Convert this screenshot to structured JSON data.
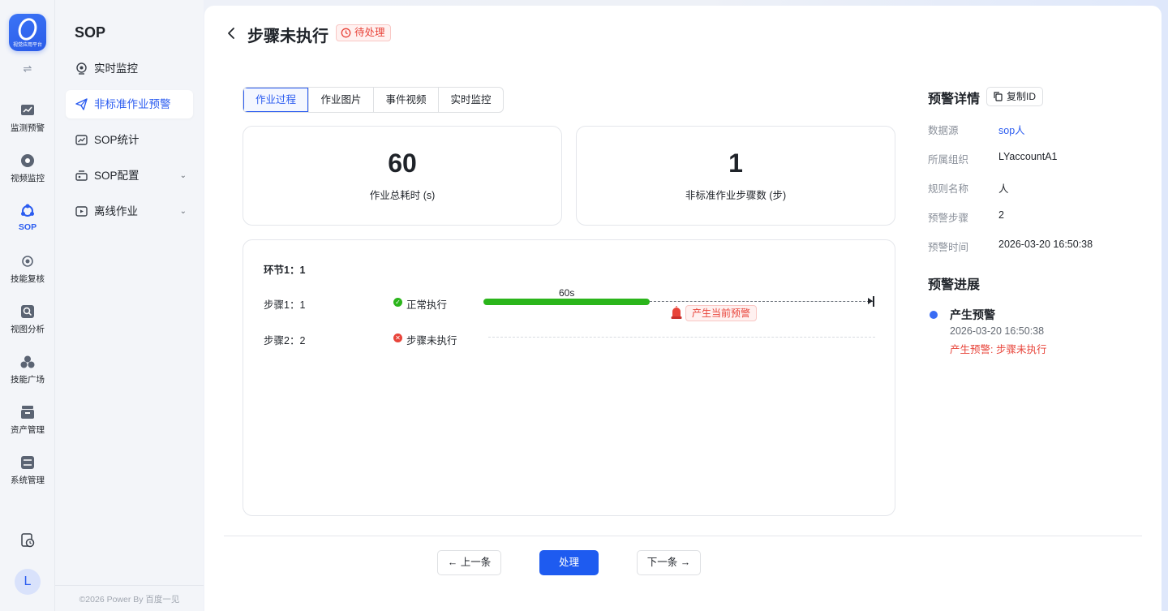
{
  "rail": {
    "logo_caption": "视觉应用平台",
    "toggle": "⇌",
    "items": [
      {
        "label": "监测预警",
        "icon": "chart-icon"
      },
      {
        "label": "视频监控",
        "icon": "camera-icon"
      },
      {
        "label": "SOP",
        "icon": "sop-icon",
        "active": true
      },
      {
        "label": "技能复核",
        "icon": "skill-review-icon"
      },
      {
        "label": "视图分析",
        "icon": "view-analysis-icon"
      },
      {
        "label": "技能广场",
        "icon": "skill-square-icon"
      },
      {
        "label": "资产管理",
        "icon": "asset-icon"
      },
      {
        "label": "系统管理",
        "icon": "system-icon"
      }
    ],
    "avatar_letter": "L"
  },
  "menu": {
    "title": "SOP",
    "items": [
      {
        "label": "实时监控",
        "icon": "monitor-icon"
      },
      {
        "label": "非标准作业预警",
        "icon": "send-icon",
        "active": true
      },
      {
        "label": "SOP统计",
        "icon": "stats-icon"
      },
      {
        "label": "SOP配置",
        "icon": "config-icon",
        "expandable": true
      },
      {
        "label": "离线作业",
        "icon": "offline-icon",
        "expandable": true
      }
    ],
    "footer": "©2026 Power By 百度一见"
  },
  "header": {
    "title": "步骤未执行",
    "status": "待处理"
  },
  "tabs": [
    "作业过程",
    "作业图片",
    "事件视频",
    "实时监控"
  ],
  "stats": [
    {
      "value": "60",
      "label": "作业总耗时 (s)"
    },
    {
      "value": "1",
      "label": "非标准作业步骤数 (步)"
    }
  ],
  "timeline": {
    "segment": "环节1：1",
    "steps": [
      {
        "label": "步骤1：1",
        "status": "正常执行",
        "state": "ok",
        "duration": "60s"
      },
      {
        "label": "步骤2：2",
        "status": "步骤未执行",
        "state": "error"
      }
    ],
    "alarm_label": "产生当前预警"
  },
  "details": {
    "title": "预警详情",
    "copy_label": "复制ID",
    "rows": [
      {
        "key": "数据源",
        "value": "sop人",
        "link": true
      },
      {
        "key": "所属组织",
        "value": "LYaccountA1"
      },
      {
        "key": "规则名称",
        "value": "人"
      },
      {
        "key": "预警步骤",
        "value": "2"
      },
      {
        "key": "预警时间",
        "value": "2026-03-20 16:50:38"
      }
    ]
  },
  "progress": {
    "title": "预警进展",
    "event": "产生预警",
    "time": "2026-03-20 16:50:38",
    "desc": "产生预警: 步骤未执行"
  },
  "footer": {
    "prev": "← 上一条",
    "process": "处理",
    "next": "下一条 →"
  },
  "colors": {
    "accent": "#2b5cf0",
    "primary_button": "#1e5bf0",
    "success": "#2bb51b",
    "danger": "#e8443a"
  }
}
